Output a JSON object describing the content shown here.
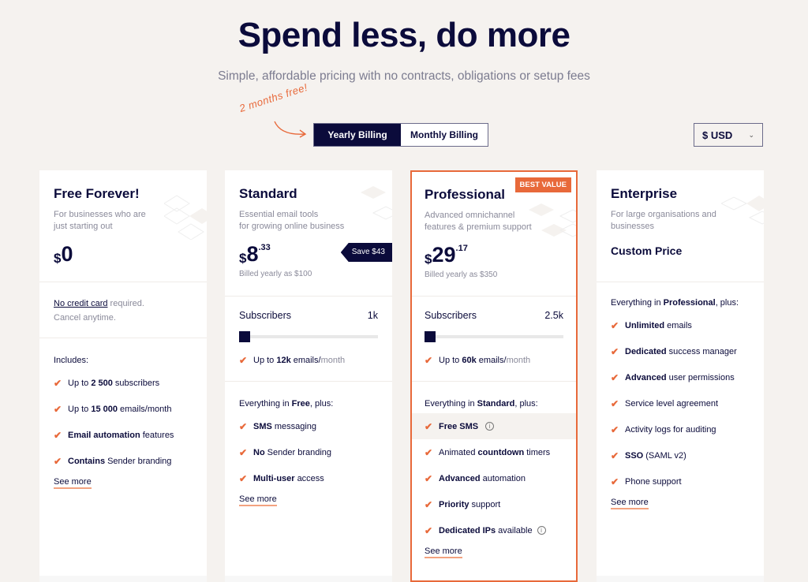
{
  "header": {
    "title": "Spend less, do more",
    "subtitle": "Simple, affordable pricing with no contracts, obligations or setup fees"
  },
  "billing": {
    "promo": "2 months free!",
    "options": [
      "Yearly Billing",
      "Monthly Billing"
    ],
    "selected": "Yearly Billing"
  },
  "currency": {
    "selected": "$ USD"
  },
  "colors": {
    "primary": "#0b0b3b",
    "accent": "#e8693a",
    "background": "#f5f2ef"
  },
  "plans": [
    {
      "name": "Free Forever!",
      "description_lines": [
        "For businesses who are",
        "just starting out"
      ],
      "currency_symbol": "$",
      "price_main": "0",
      "note_link": "No credit card",
      "note_rest": " required.",
      "note_line2": "Cancel anytime.",
      "includes_label": "Includes:",
      "features": [
        {
          "pre": "Up to ",
          "bold": "2 500",
          "post": " subscribers"
        },
        {
          "pre": "Up to ",
          "bold": "15 000",
          "post": " emails/month"
        },
        {
          "pre": "",
          "bold": "Email automation",
          "post": " features"
        },
        {
          "pre": "",
          "bold": "Contains",
          "post": " Sender branding"
        }
      ],
      "see_more": "See more"
    },
    {
      "name": "Standard",
      "description_lines": [
        "Essential email tools",
        "for growing online business"
      ],
      "currency_symbol": "$",
      "price_main": "8",
      "price_cents": ".33",
      "billed": "Billed yearly as $100",
      "save_tag": "Save $43",
      "subscribers_label": "Subscribers",
      "subscribers_value": "1k",
      "slider_position": 0,
      "emails": {
        "pre": "Up to ",
        "bold": "12k",
        "post": " emails/",
        "muted": "month"
      },
      "includes_pre": "Everything in ",
      "includes_bold": "Free",
      "includes_post": ", plus:",
      "features": [
        {
          "pre": "",
          "bold": "SMS",
          "post": " messaging"
        },
        {
          "pre": "",
          "bold": "No",
          "post": " Sender branding"
        },
        {
          "pre": "",
          "bold": "Multi-user",
          "post": " access"
        }
      ],
      "see_more": "See more"
    },
    {
      "name": "Professional",
      "badge": "BEST VALUE",
      "description_lines": [
        "Advanced omnichannel",
        "features & premium support"
      ],
      "currency_symbol": "$",
      "price_main": "29",
      "price_cents": ".17",
      "billed": "Billed yearly as $350",
      "subscribers_label": "Subscribers",
      "subscribers_value": "2.5k",
      "slider_position": 0,
      "emails": {
        "pre": "Up to ",
        "bold": "60k",
        "post": " emails/",
        "muted": "month"
      },
      "includes_pre": "Everything in ",
      "includes_bold": "Standard",
      "includes_post": ", plus:",
      "features": [
        {
          "pre": "",
          "bold": "Free SMS",
          "post": "",
          "info": true,
          "highlight": true
        },
        {
          "pre": "Animated ",
          "bold": "countdown",
          "post": " timers"
        },
        {
          "pre": "",
          "bold": "Advanced",
          "post": " automation"
        },
        {
          "pre": "",
          "bold": "Priority",
          "post": " support"
        },
        {
          "pre": "",
          "bold": "Dedicated IPs",
          "post": " available",
          "info": true
        }
      ],
      "see_more": "See more"
    },
    {
      "name": "Enterprise",
      "description_lines": [
        "For large organisations and",
        "businesses"
      ],
      "custom_price": "Custom Price",
      "includes_pre": "Everything in ",
      "includes_bold": "Professional",
      "includes_post": ", plus:",
      "features": [
        {
          "pre": "",
          "bold": "Unlimited",
          "post": " emails"
        },
        {
          "pre": "",
          "bold": "Dedicated",
          "post": " success manager"
        },
        {
          "pre": "",
          "bold": "Advanced",
          "post": " user permissions"
        },
        {
          "pre": "Service level agreement",
          "bold": "",
          "post": ""
        },
        {
          "pre": "Activity logs for auditing",
          "bold": "",
          "post": ""
        },
        {
          "pre": "",
          "bold": "SSO",
          "post": " (SAML v2)"
        },
        {
          "pre": "Phone support",
          "bold": "",
          "post": ""
        }
      ],
      "see_more": "See more"
    }
  ],
  "icons": {
    "check": "✔",
    "info": "i",
    "chevron": "⌄"
  }
}
